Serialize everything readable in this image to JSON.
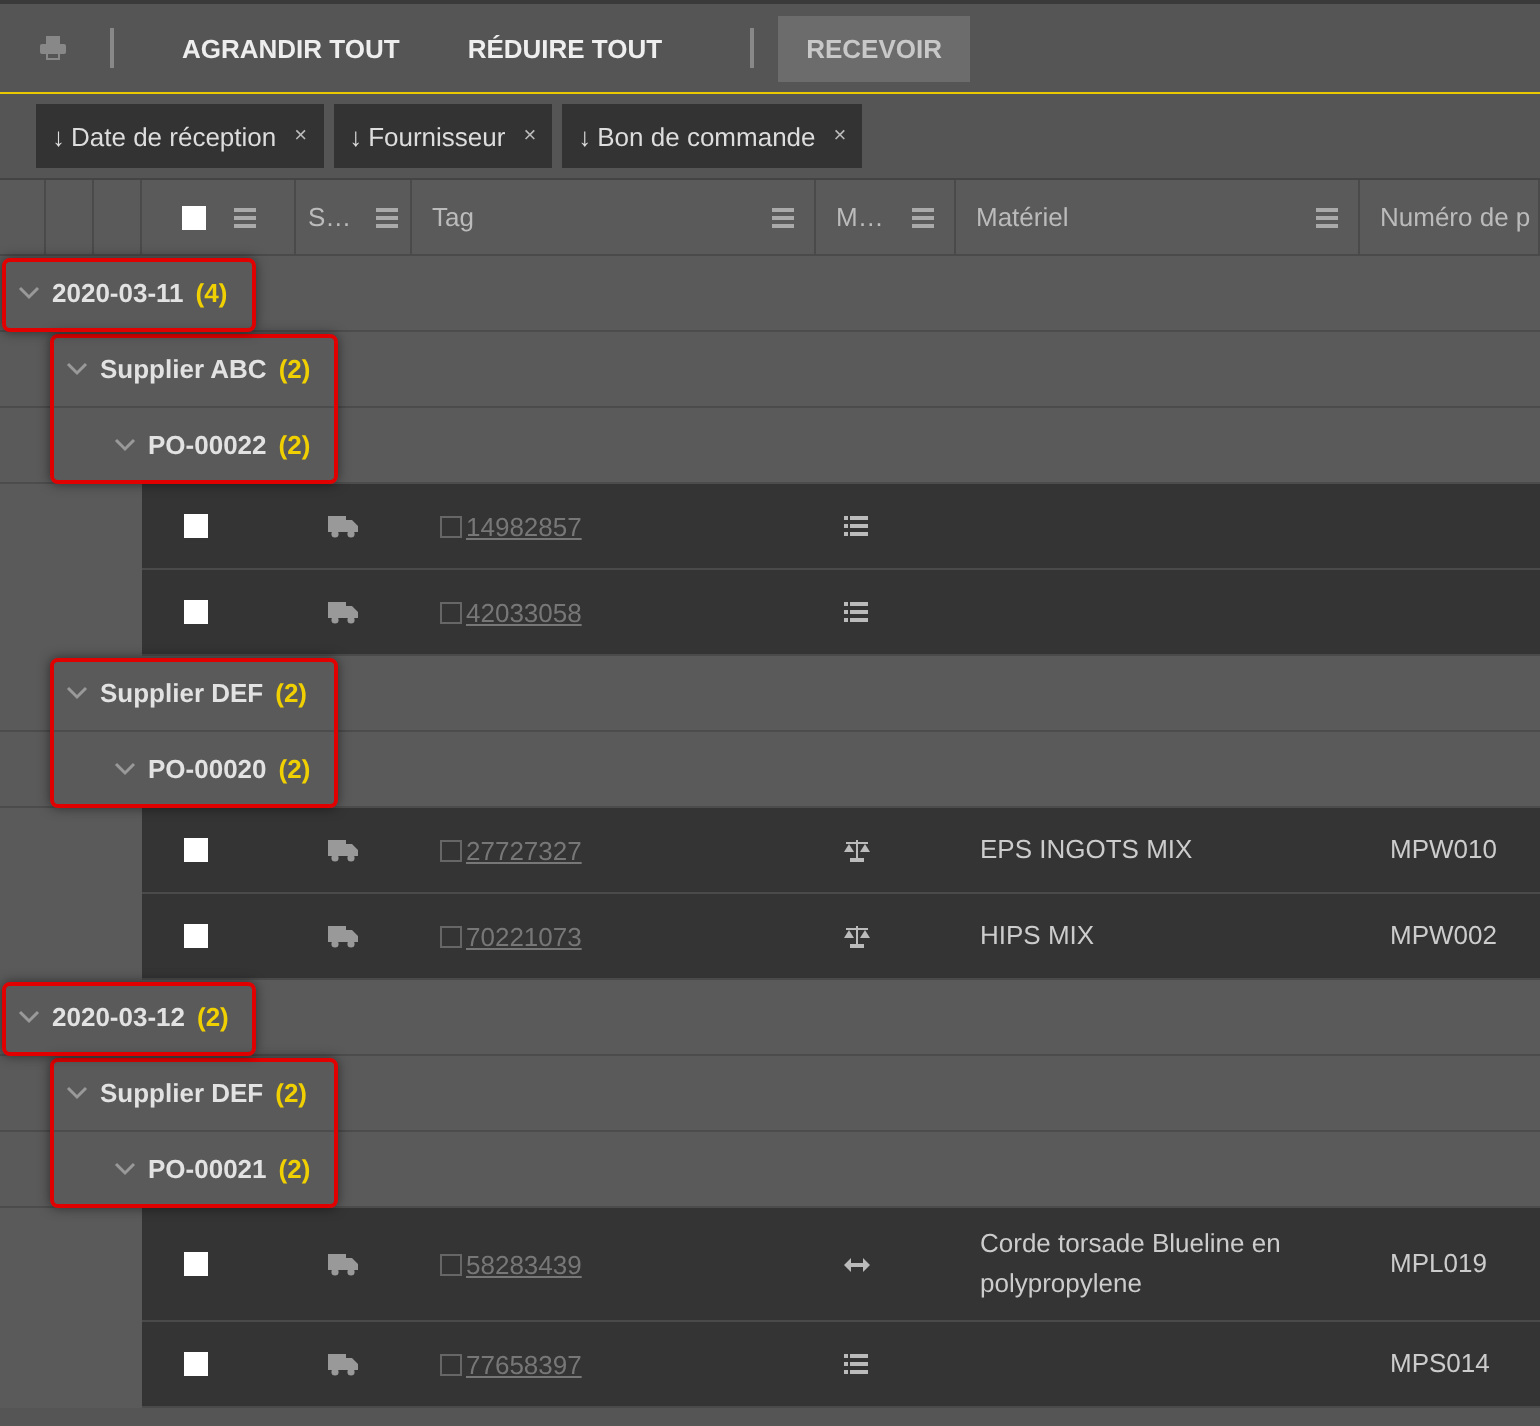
{
  "toolbar": {
    "buttons": [
      {
        "label": "AGRANDIR TOUT",
        "disabled": false
      },
      {
        "label": "RÉDUIRE TOUT",
        "disabled": false
      },
      {
        "label": "RECEVOIR",
        "disabled": true
      }
    ]
  },
  "group_chips": [
    {
      "sort": "↓",
      "label": "Date de réception",
      "remove": "×"
    },
    {
      "sort": "↓",
      "label": "Fournisseur",
      "remove": "×"
    },
    {
      "sort": "↓",
      "label": "Bon de commande",
      "remove": "×"
    }
  ],
  "table": {
    "header_checkbox": {
      "checked": false
    },
    "columns": [
      {
        "label": "S…",
        "menu": true
      },
      {
        "label": "Tag",
        "menu": true
      },
      {
        "label": "M…",
        "menu": true
      },
      {
        "label": "Matériel",
        "menu": true
      },
      {
        "label": "Numéro de p",
        "menu": false
      }
    ],
    "groups": [
      {
        "label": "2020-03-11",
        "count": "(4)",
        "expanded": true,
        "highlighted": true,
        "children": [
          {
            "label": "Supplier ABC",
            "count": "(2)",
            "expanded": true,
            "highlighted": true,
            "children": [
              {
                "label": "PO-00022",
                "count": "(2)",
                "expanded": true,
                "rows": [
                  {
                    "checked": false,
                    "tag": "14982857",
                    "kind": "list"
                  },
                  {
                    "checked": false,
                    "tag": "42033058",
                    "kind": "list"
                  }
                ]
              }
            ]
          },
          {
            "label": "Supplier DEF",
            "count": "(2)",
            "expanded": true,
            "highlighted": true,
            "children": [
              {
                "label": "PO-00020",
                "count": "(2)",
                "expanded": true,
                "rows": [
                  {
                    "checked": false,
                    "tag": "27727327",
                    "kind": "scale",
                    "material": "EPS INGOTS MIX",
                    "part": "MPW010"
                  },
                  {
                    "checked": false,
                    "tag": "70221073",
                    "kind": "scale",
                    "material": "HIPS MIX",
                    "part": "MPW002"
                  }
                ]
              }
            ]
          }
        ]
      },
      {
        "label": "2020-03-12",
        "count": "(2)",
        "expanded": true,
        "highlighted": true,
        "children": [
          {
            "label": "Supplier DEF",
            "count": "(2)",
            "expanded": true,
            "highlighted": true,
            "children": [
              {
                "label": "PO-00021",
                "count": "(2)",
                "expanded": true,
                "rows": [
                  {
                    "checked": false,
                    "tag": "58283439",
                    "kind": "arrows",
                    "material": "Corde torsade Blueline en polypropylene",
                    "part": "MPL019"
                  },
                  {
                    "checked": false,
                    "tag": "77658397",
                    "kind": "list",
                    "part": "MPS014"
                  }
                ]
              }
            ]
          }
        ]
      }
    ]
  }
}
